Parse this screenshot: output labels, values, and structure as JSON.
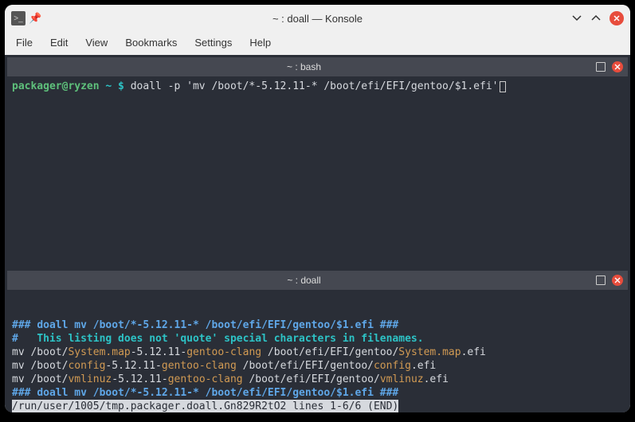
{
  "window": {
    "title": "~ : doall — Konsole"
  },
  "menu": {
    "file": "File",
    "edit": "Edit",
    "view": "View",
    "bookmarks": "Bookmarks",
    "settings": "Settings",
    "help": "Help"
  },
  "pane1": {
    "title": "~ : bash",
    "prompt_user": "packager@ryzen",
    "prompt_path": " ~ $ ",
    "command": "doall -p 'mv /boot/*-5.12.11-* /boot/efi/EFI/gentoo/$1.efi'"
  },
  "pane2": {
    "title": "~ : doall",
    "line1": {
      "hash_prefix": "### ",
      "cmd": "doall mv /boot/*-5.12.11-* /boot/efi/EFI/gentoo/$1.efi",
      "hash_suffix": " ###"
    },
    "line2": {
      "hash": "#   ",
      "text": "This listing does not 'quote' special characters in filenames."
    },
    "rows": [
      {
        "pre": "mv /boot/",
        "fn": "System.map",
        "mid": "-5.12.11-",
        "tag": "gentoo-clang",
        "post1": " /boot/efi/EFI/gentoo/",
        "fn2": "System.map",
        "post2": ".efi"
      },
      {
        "pre": "mv /boot/",
        "fn": "config",
        "mid": "-5.12.11-",
        "tag": "gentoo-clang",
        "post1": " /boot/efi/EFI/gentoo/",
        "fn2": "config",
        "post2": ".efi"
      },
      {
        "pre": "mv /boot/",
        "fn": "vmlinuz",
        "mid": "-5.12.11-",
        "tag": "gentoo-clang",
        "post1": " /boot/efi/EFI/gentoo/",
        "fn2": "vmlinuz",
        "post2": ".efi"
      }
    ],
    "line6": {
      "hash_prefix": "### ",
      "cmd": "doall mv /boot/*-5.12.11-* /boot/efi/EFI/gentoo/$1.efi",
      "hash_suffix": " ###"
    },
    "status": "/run/user/1005/tmp.packager.doall.Gn829R2tO2 lines 1-6/6 (END)"
  }
}
